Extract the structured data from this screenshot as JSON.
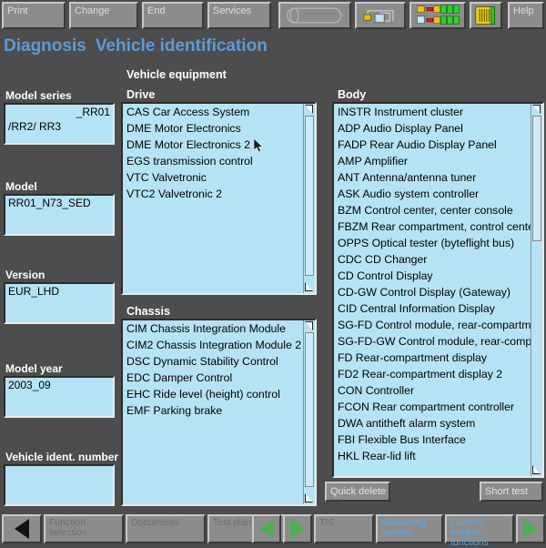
{
  "toolbar": {
    "buttons": [
      {
        "name": "print-button",
        "label": "Print"
      },
      {
        "name": "change-button",
        "label": "Change"
      },
      {
        "name": "end-button",
        "label": "End"
      },
      {
        "name": "services-button",
        "label": "Services"
      }
    ],
    "icon_buttons": [
      {
        "name": "capsule-icon-button",
        "icon": "capsule-icon"
      },
      {
        "name": "network-connection-icon-button",
        "icon": "network-connection-icon"
      },
      {
        "name": "module-status-icon-button",
        "icon": "module-status-bars-icon"
      },
      {
        "name": "connector-icon-button",
        "icon": "connector-icon"
      }
    ],
    "help_label": "Help"
  },
  "header": {
    "breadcrumb_1": "Diagnosis",
    "breadcrumb_2": "Vehicle identification"
  },
  "left_panel": {
    "fields": [
      {
        "name": "model-series-field",
        "label": "Model series",
        "value_right": "_RR01",
        "value_left": "/RR2/ RR3"
      },
      {
        "name": "model-field",
        "label": "Model",
        "value_left": "RR01_N73_SED",
        "value_right": ""
      },
      {
        "name": "version-field",
        "label": "Version",
        "value_left": "EUR_LHD",
        "value_right": ""
      },
      {
        "name": "model-year-field",
        "label": "Model year",
        "value_left": "2003_09",
        "value_right": ""
      },
      {
        "name": "vehicle-ident-number-field",
        "label": "Vehicle ident. number",
        "value_left": "",
        "value_right": ""
      }
    ]
  },
  "equipment": {
    "section_title": "Vehicle equipment",
    "drive": {
      "title": "Drive",
      "items": [
        "CAS Car Access System",
        "DME Motor Electronics",
        "DME Motor Electronics 2",
        "EGS transmission control",
        "VTC Valvetronic",
        "VTC2 Valvetronic 2"
      ]
    },
    "chassis": {
      "title": "Chassis",
      "items": [
        "CIM Chassis Integration Module",
        "CIM2 Chassis Integration Module 2",
        "DSC Dynamic Stability Control",
        "EDC Damper Control",
        "EHC Ride level (height) control",
        "EMF Parking brake"
      ]
    },
    "body": {
      "title": "Body",
      "items": [
        "INSTR Instrument cluster",
        "ADP Audio Display Panel",
        "FADP Rear Audio Display Panel",
        "AMP Amplifier",
        "ANT Antenna/antenna tuner",
        "ASK Audio system controller",
        "BZM Control center, center console",
        "FBZM Rear compartment, control center, ce",
        "OPPS Optical tester (byteflight bus)",
        "CDC CD Changer",
        "CD Control Display",
        "CD-GW Control Display (Gateway)",
        "CID Central Information Display",
        "SG-FD Control module, rear-compartment",
        "SG-FD-GW Control module, rear-compart",
        "FD Rear-compartment display",
        "FD2 Rear-compartment display 2",
        "CON Controller",
        "FCON Rear compartment controller",
        "DWA antitheft alarm system",
        "FBI Flexible Bus Interface",
        "HKL Rear-lid lift"
      ]
    }
  },
  "actions": {
    "quick_delete": "Quick delete",
    "short_test": "Short test"
  },
  "navbar": {
    "back_arrow": "back-arrow-icon",
    "function_selection": "Function\nselection",
    "documents": "Documents",
    "test_plan": "Test plan",
    "prev_arrow": "prev-arrow-icon",
    "next_arrow": "next-arrow-icon",
    "tis": "TIS",
    "measuring_system": "Measuring\nsystem",
    "control_module_functions": "Control-module\nfunctions",
    "forward_arrow": "forward-arrow-icon"
  },
  "colors": {
    "background": "#4d4d4d",
    "field_blue": "#b5e3f5",
    "accent_blue": "#5b9bd5",
    "button_gray": "#8c8c8c",
    "green_arrow": "#4caf50"
  }
}
